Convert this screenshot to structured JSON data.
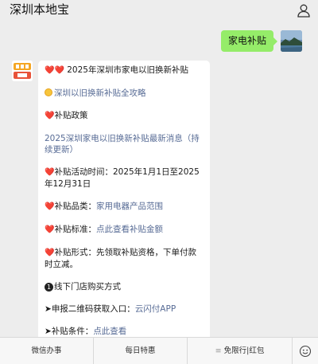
{
  "header": {
    "title": "深圳本地宝"
  },
  "user_message": {
    "text": "家电补贴"
  },
  "bot_message": {
    "p1_prefix": "❤️❤️",
    "p1_text": "2025年深圳市家电以旧换新补贴",
    "p2_link": "深圳以旧换新补贴全攻略",
    "p3_text": "补贴政策",
    "p4_link": "2025深圳家电以旧换新补贴最新消息（持续更新）",
    "p5_text": "补贴活动时间：2025年1月1日至2025年12月31日",
    "p6_label": "补贴品类：",
    "p6_link": "家用电器产品范围",
    "p7_label": "补贴标准：",
    "p7_link": "点此查看补贴金额",
    "p8_text": "补贴形式：先领取补贴资格，下单付款时立减。",
    "p9_badge": "1",
    "p9_text": "线下门店购买方式",
    "p10_arrow": "➤",
    "p10_label": "申报二维码获取入口：",
    "p10_link": "云闪付APP",
    "p11_arrow": "➤",
    "p11_label": "补贴条件：",
    "p11_link": "点此查看"
  },
  "bottom_menu": {
    "tab1": "微信办事",
    "tab2": "每日特惠",
    "tab3_prefix": "≡",
    "tab3": "免限行|红包"
  },
  "icons": {
    "user": "user-icon",
    "emoji": "emoji-icon",
    "heart": "heart-icon"
  },
  "colors": {
    "link": "#576b95",
    "user_bubble": "#95ec69",
    "heart": "#e0303c"
  }
}
